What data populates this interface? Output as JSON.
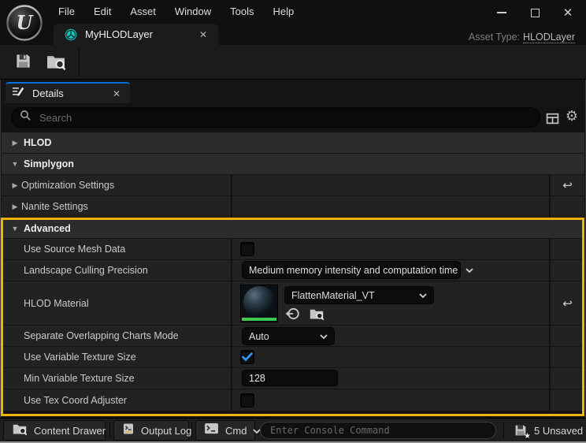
{
  "title_bar": {
    "menu_items": [
      "File",
      "Edit",
      "Asset",
      "Window",
      "Tools",
      "Help"
    ]
  },
  "asset_tab": {
    "label": "MyHLODLayer"
  },
  "asset_type": {
    "label": "Asset Type:",
    "value": "HLODLayer"
  },
  "details": {
    "tab_label": "Details",
    "search_placeholder": "Search",
    "categories": {
      "hlod": "HLOD",
      "simplygon": "Simplygon",
      "advanced": "Advanced"
    },
    "rows": {
      "optimization_settings": {
        "label": "Optimization Settings"
      },
      "nanite_settings": {
        "label": "Nanite Settings"
      },
      "use_source_mesh_data": {
        "label": "Use Source Mesh Data",
        "checked": false
      },
      "landscape_culling_precision": {
        "label": "Landscape Culling Precision",
        "value": "Medium memory intensity and computation time"
      },
      "hlod_material": {
        "label": "HLOD Material",
        "value": "FlattenMaterial_VT"
      },
      "separate_overlapping_charts_mode": {
        "label": "Separate Overlapping Charts Mode",
        "value": "Auto"
      },
      "use_variable_texture_size": {
        "label": "Use Variable Texture Size",
        "checked": true
      },
      "min_variable_texture_size": {
        "label": "Min Variable Texture Size",
        "value": "128"
      },
      "use_tex_coord_adjuster": {
        "label": "Use Tex Coord Adjuster",
        "checked": false
      }
    }
  },
  "status_bar": {
    "content_drawer": "Content Drawer",
    "output_log": "Output Log",
    "cmd": "Cmd",
    "console_placeholder": "Enter Console Command",
    "unsaved": "5 Unsaved"
  },
  "colors": {
    "accent_blue": "#0070E0",
    "highlight_yellow": "#F0B400",
    "check_blue": "#2E9BFF",
    "material_green": "#3CC84E",
    "tab_icon_teal": "#17C5C2"
  }
}
